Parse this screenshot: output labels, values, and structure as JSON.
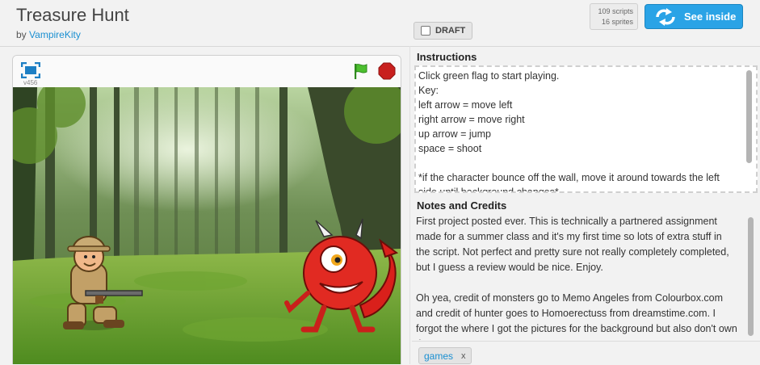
{
  "project": {
    "title": "Treasure Hunt",
    "by_prefix": "by",
    "author": "VampireKity"
  },
  "draft_label": "DRAFT",
  "stats": {
    "scripts": "109 scripts",
    "sprites": "16 sprites"
  },
  "see_inside_label": "See inside",
  "player": {
    "version": "v456"
  },
  "instructions": {
    "heading": "Instructions",
    "text": "Click green flag to start playing.\nKey:\nleft arrow = move left\nright arrow = move right\nup arrow = jump\nspace = shoot\n\n*if the character bounce off the wall, move it around towards the left side until background changes*"
  },
  "notes": {
    "heading": "Notes and Credits",
    "text": "First project posted ever. This is technically a partnered assignment made for a summer class and it's my first time so lots of extra stuff in the script. Not perfect and pretty sure not really completely completed, but I guess a review would be nice. Enjoy.\n\nOh yea, credit of monsters go to Memo Angeles from Colourbox.com and credit of hunter goes to Homoerectuss from dreamstime.com. I forgot the where I got the pictures for the background but also don't own them."
  },
  "tags": [
    {
      "label": "games",
      "remove": "x"
    }
  ],
  "colors": {
    "accent": "#2aa3e6",
    "link": "#1a8fd1",
    "flag": "#4cbf2f",
    "stop": "#c8201e"
  }
}
